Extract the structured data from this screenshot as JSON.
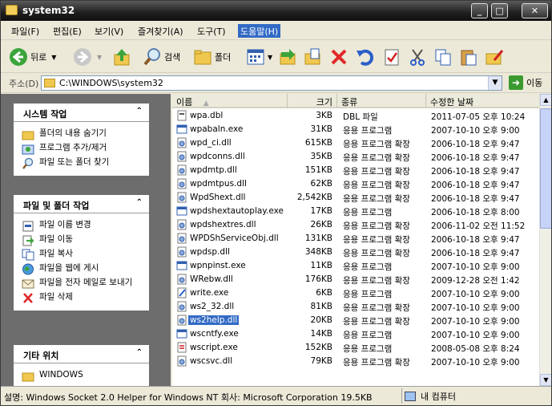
{
  "window": {
    "title": "system32"
  },
  "titlebar_buttons": {
    "minimize": "_",
    "maximize": "□",
    "close": "✕"
  },
  "menu": [
    "파일(F)",
    "편집(E)",
    "보기(V)",
    "즐겨찾기(A)",
    "도구(T)",
    "도움말(H)"
  ],
  "toolbar": {
    "back": "뒤로",
    "search": "검색",
    "folders": "폴더"
  },
  "address": {
    "label": "주소(D)",
    "path": "C:\\WINDOWS\\system32",
    "go": "이동"
  },
  "taskpane": {
    "system_tasks": {
      "title": "시스템 작업",
      "items": [
        "폴더의 내용 숨기기",
        "프로그램 추가/제거",
        "파일 또는 폴더 찾기"
      ]
    },
    "file_tasks": {
      "title": "파일 및 폴더 작업",
      "items": [
        "파일 이름 변경",
        "파일 이동",
        "파일 복사",
        "파일을 웹에 게시",
        "파일을 전자 메일로 보내기",
        "파일 삭제"
      ]
    },
    "other_places": {
      "title": "기타 위치",
      "items": [
        "WINDOWS"
      ]
    }
  },
  "columns": [
    "이름",
    "크기",
    "종류",
    "수정한 날짜"
  ],
  "files": [
    {
      "name": "wpa.dbl",
      "size": "3KB",
      "type": "DBL 파일",
      "date": "2011-07-05 오후 10:24",
      "icon": "file-icon"
    },
    {
      "name": "wpabaln.exe",
      "size": "31KB",
      "type": "응용 프로그램",
      "date": "2007-10-10 오후 9:00",
      "icon": "app-icon"
    },
    {
      "name": "wpd_ci.dll",
      "size": "615KB",
      "type": "응용 프로그램 확장",
      "date": "2006-10-18 오후 9:47",
      "icon": "dll-icon"
    },
    {
      "name": "wpdconns.dll",
      "size": "35KB",
      "type": "응용 프로그램 확장",
      "date": "2006-10-18 오후 9:47",
      "icon": "dll-icon"
    },
    {
      "name": "wpdmtp.dll",
      "size": "151KB",
      "type": "응용 프로그램 확장",
      "date": "2006-10-18 오후 9:47",
      "icon": "dll-icon"
    },
    {
      "name": "wpdmtpus.dll",
      "size": "62KB",
      "type": "응용 프로그램 확장",
      "date": "2006-10-18 오후 9:47",
      "icon": "dll-icon"
    },
    {
      "name": "WpdShext.dll",
      "size": "2,542KB",
      "type": "응용 프로그램 확장",
      "date": "2006-10-18 오후 9:47",
      "icon": "dll-icon"
    },
    {
      "name": "wpdshextautoplay.exe",
      "size": "17KB",
      "type": "응용 프로그램",
      "date": "2006-10-18 오후 8:00",
      "icon": "app-icon"
    },
    {
      "name": "wpdshextres.dll",
      "size": "26KB",
      "type": "응용 프로그램 확장",
      "date": "2006-11-02 오전 11:52",
      "icon": "dll-icon"
    },
    {
      "name": "WPDShServiceObj.dll",
      "size": "131KB",
      "type": "응용 프로그램 확장",
      "date": "2006-10-18 오후 9:47",
      "icon": "dll-icon"
    },
    {
      "name": "wpdsp.dll",
      "size": "348KB",
      "type": "응용 프로그램 확장",
      "date": "2006-10-18 오후 9:47",
      "icon": "dll-icon"
    },
    {
      "name": "wpnpinst.exe",
      "size": "11KB",
      "type": "응용 프로그램",
      "date": "2007-10-10 오후 9:00",
      "icon": "app-icon"
    },
    {
      "name": "WRebw.dll",
      "size": "176KB",
      "type": "응용 프로그램 확장",
      "date": "2009-12-28 오전 1:42",
      "icon": "dll-icon"
    },
    {
      "name": "write.exe",
      "size": "6KB",
      "type": "응용 프로그램",
      "date": "2007-10-10 오후 9:00",
      "icon": "write-icon"
    },
    {
      "name": "ws2_32.dll",
      "size": "81KB",
      "type": "응용 프로그램 확장",
      "date": "2007-10-10 오후 9:00",
      "icon": "dll-icon"
    },
    {
      "name": "ws2help.dll",
      "size": "20KB",
      "type": "응용 프로그램 확장",
      "date": "2007-10-10 오후 9:00",
      "icon": "dll-icon",
      "selected": true
    },
    {
      "name": "wscntfy.exe",
      "size": "14KB",
      "type": "응용 프로그램",
      "date": "2007-10-10 오후 9:00",
      "icon": "app-icon"
    },
    {
      "name": "wscript.exe",
      "size": "152KB",
      "type": "응용 프로그램",
      "date": "2008-05-08 오후 8:24",
      "icon": "script-icon"
    },
    {
      "name": "wscsvc.dll",
      "size": "79KB",
      "type": "응용 프로그램 확장",
      "date": "2007-10-10 오후 9:00",
      "icon": "dll-icon"
    }
  ],
  "status": {
    "text": "설명: Windows Socket 2.0 Helper for Windows NT 회사: Microsoft Corporation 19.5KB",
    "zone": "내 컴퓨터"
  },
  "colors": {
    "selection": "#316ac5",
    "taskpane_bg": "#6d6d6d",
    "titlebar": "#1e1e1e"
  }
}
